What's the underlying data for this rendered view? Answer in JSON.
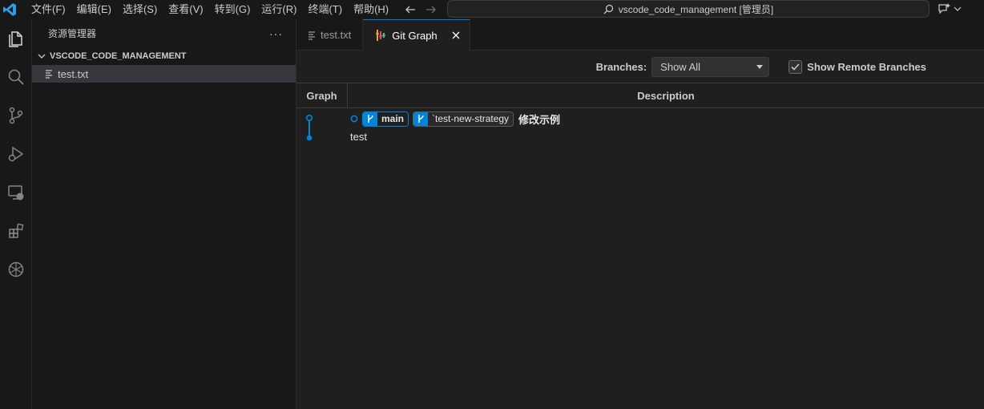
{
  "menu": [
    "文件(F)",
    "编辑(E)",
    "选择(S)",
    "查看(V)",
    "转到(G)",
    "运行(R)",
    "终端(T)",
    "帮助(H)"
  ],
  "command_center": {
    "text": "vscode_code_management [管理员]"
  },
  "sidebar": {
    "title": "资源管理器",
    "more": "···",
    "section": "VSCODE_CODE_MANAGEMENT",
    "file": "test.txt"
  },
  "tabs": [
    {
      "label": "test.txt",
      "active": false
    },
    {
      "label": "Git Graph",
      "active": true
    }
  ],
  "controls": {
    "branches_label": "Branches:",
    "branches_value": "Show All",
    "remote_label": "Show Remote Branches",
    "remote_checked": true
  },
  "table": {
    "col_graph": "Graph",
    "col_desc": "Description"
  },
  "commits": [
    {
      "refs": [
        "main",
        "`test-new-strategy"
      ],
      "message": "修改示例"
    },
    {
      "refs": [],
      "message": "test"
    }
  ],
  "colors": {
    "accent": "#0078d4",
    "branch": "#0085d9"
  }
}
